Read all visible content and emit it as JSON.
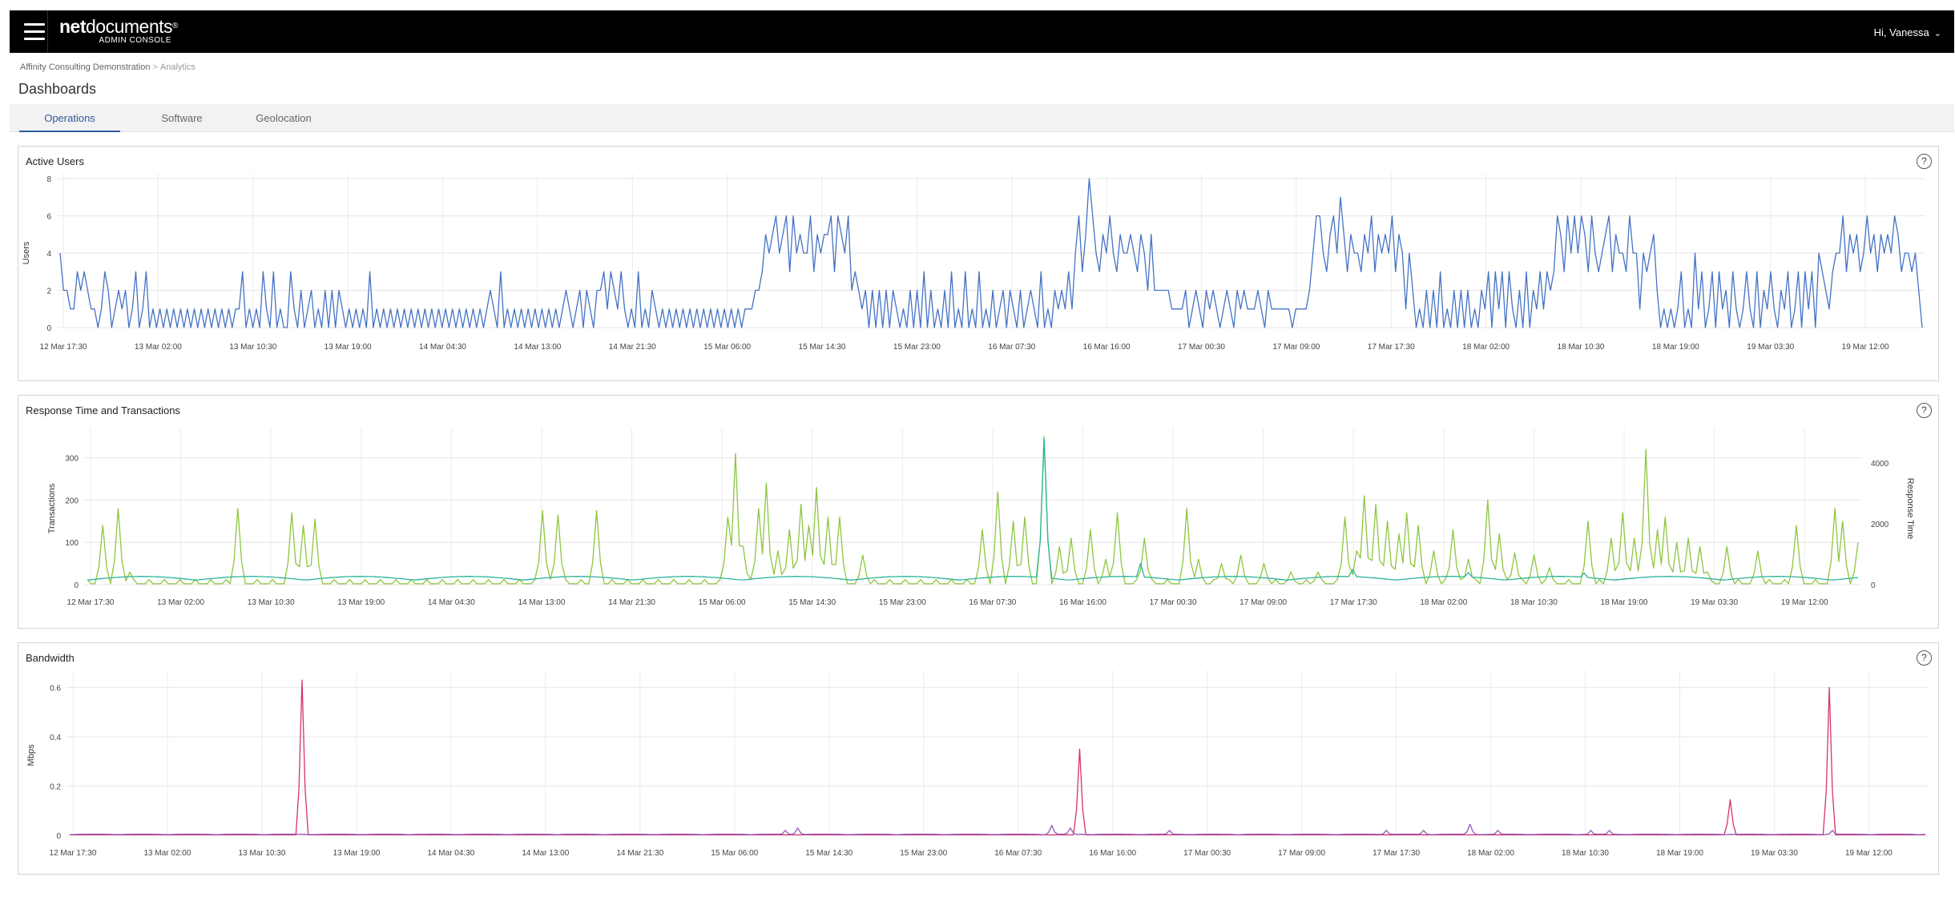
{
  "header": {
    "brand_bold": "net",
    "brand_light": "documents",
    "brand_mark": "®",
    "brand_sub": "ADMIN CONSOLE",
    "user_greeting": "Hi, Vanessa",
    "chevron_icon": "chevron-down-icon",
    "menu_icon": "hamburger-menu-icon"
  },
  "breadcrumb": {
    "items": [
      "Affinity Consulting Demonstration",
      "Analytics"
    ],
    "separator": ">"
  },
  "page": {
    "title": "Dashboards"
  },
  "tabs": [
    {
      "label": "Operations",
      "active": true
    },
    {
      "label": "Software",
      "active": false
    },
    {
      "label": "Geolocation",
      "active": false
    }
  ],
  "colors": {
    "accent": "#2e5aa0",
    "active_users": "#4472c4",
    "transactions": "#8dc63f",
    "response_time": "#2bb59b",
    "bandwidth_a": "#d6336c",
    "bandwidth_b": "#9b59b6"
  },
  "panels": {
    "active_users": {
      "title": "Active Users",
      "help": "?"
    },
    "response": {
      "title": "Response Time and Transactions",
      "help": "?"
    },
    "bandwidth": {
      "title": "Bandwidth",
      "help": "?"
    }
  },
  "chart_data": [
    {
      "id": "active_users",
      "type": "line",
      "title": "Active Users",
      "xlabel": "",
      "ylabel": "Users",
      "ylim": [
        0,
        8
      ],
      "yticks": [
        0,
        2,
        4,
        6,
        8
      ],
      "grid": true,
      "x_tick_labels": [
        "12 Mar 17:30",
        "13 Mar 02:00",
        "13 Mar 10:30",
        "13 Mar 19:00",
        "14 Mar 04:30",
        "14 Mar 13:00",
        "14 Mar 21:30",
        "15 Mar 06:00",
        "15 Mar 14:30",
        "15 Mar 23:00",
        "16 Mar 07:30",
        "16 Mar 16:00",
        "17 Mar 00:30",
        "17 Mar 09:00",
        "17 Mar 17:30",
        "18 Mar 02:00",
        "18 Mar 10:30",
        "18 Mar 19:00",
        "19 Mar 03:30",
        "19 Mar 12:00"
      ],
      "series": [
        {
          "color": "#4472c4",
          "values": [
            4,
            2,
            2,
            1,
            1,
            3,
            2,
            3,
            2,
            1,
            1,
            0,
            1,
            3,
            2,
            0,
            1,
            2,
            1,
            2,
            0,
            1,
            3,
            0,
            1,
            3,
            0,
            1,
            0,
            1,
            0,
            1,
            0,
            1,
            0,
            1,
            0,
            1,
            0,
            1,
            0,
            1,
            0,
            1,
            0,
            1,
            0,
            1,
            0,
            1,
            0,
            1,
            1,
            3,
            0,
            1,
            0,
            1,
            0,
            3,
            1,
            0,
            3,
            0,
            1,
            0,
            0,
            3,
            1,
            0,
            2,
            0,
            1,
            2,
            0,
            1,
            0,
            2,
            0,
            2,
            0,
            2,
            1,
            0,
            1,
            0,
            1,
            0,
            1,
            0,
            3,
            0,
            1,
            0,
            1,
            0,
            1,
            0,
            1,
            0,
            1,
            0,
            1,
            0,
            1,
            0,
            1,
            0,
            1,
            0,
            1,
            0,
            1,
            0,
            1,
            0,
            1,
            0,
            1,
            0,
            1,
            0,
            1,
            0,
            1,
            2,
            1,
            0,
            3,
            0,
            1,
            0,
            1,
            0,
            1,
            0,
            1,
            0,
            1,
            0,
            1,
            0,
            1,
            0,
            1,
            0,
            1,
            2,
            1,
            0,
            1,
            2,
            0,
            2,
            1,
            0,
            2,
            2,
            3,
            1,
            3,
            2,
            1,
            3,
            1,
            0,
            1,
            0,
            3,
            0,
            1,
            0,
            2,
            1,
            0,
            1,
            0,
            1,
            0,
            1,
            0,
            1,
            0,
            1,
            0,
            1,
            0,
            1,
            0,
            1,
            0,
            1,
            0,
            1,
            0,
            1,
            0,
            1,
            0,
            1,
            1,
            1,
            2,
            2,
            3,
            5,
            4,
            5,
            6,
            4,
            5,
            6,
            3,
            6,
            4,
            5,
            4,
            4,
            6,
            3,
            5,
            4,
            5,
            5,
            6,
            3,
            6,
            5,
            4,
            6,
            2,
            3,
            2,
            1,
            2,
            0,
            2,
            0,
            2,
            0,
            2,
            0,
            2,
            1,
            0,
            1,
            0,
            2,
            0,
            2,
            0,
            3,
            0,
            2,
            0,
            1,
            0,
            2,
            0,
            3,
            0,
            1,
            0,
            3,
            0,
            1,
            0,
            3,
            0,
            1,
            0,
            2,
            0,
            1,
            2,
            0,
            2,
            1,
            0,
            2,
            0,
            1,
            2,
            1,
            0,
            3,
            0,
            1,
            0,
            2,
            1,
            2,
            1,
            3,
            1,
            4,
            6,
            3,
            5,
            8,
            6,
            4,
            3,
            5,
            4,
            6,
            4,
            3,
            5,
            4,
            4,
            5,
            4,
            3,
            5,
            4,
            2,
            5,
            2,
            2,
            2,
            2,
            2,
            1,
            1,
            1,
            1,
            2,
            0,
            1,
            2,
            1,
            0,
            2,
            1,
            2,
            1,
            0,
            1,
            2,
            1,
            0,
            2,
            1,
            2,
            1,
            1,
            1,
            2,
            1,
            0,
            2,
            1,
            1,
            1,
            1,
            1,
            1,
            0,
            1,
            1,
            1,
            1,
            2,
            4,
            6,
            6,
            4,
            3,
            5,
            6,
            4,
            7,
            5,
            3,
            5,
            4,
            4,
            3,
            5,
            4,
            6,
            3,
            5,
            4,
            5,
            4,
            6,
            3,
            5,
            4,
            1,
            4,
            2,
            0,
            1,
            0,
            2,
            0,
            2,
            0,
            3,
            0,
            1,
            0,
            2,
            0,
            2,
            0,
            2,
            0,
            1,
            0,
            2,
            1,
            3,
            0,
            3,
            1,
            3,
            0,
            3,
            1,
            0,
            2,
            0,
            3,
            0,
            2,
            1,
            3,
            1,
            3,
            2,
            3,
            6,
            5,
            3,
            6,
            4,
            6,
            4,
            6,
            5,
            3,
            6,
            4,
            3,
            4,
            5,
            6,
            3,
            5,
            4,
            4,
            3,
            6,
            4,
            4,
            1,
            4,
            3,
            4,
            5,
            2,
            0,
            1,
            0,
            1,
            0,
            1,
            3,
            0,
            1,
            0,
            4,
            1,
            3,
            0,
            1,
            3,
            0,
            3,
            1,
            2,
            0,
            3,
            1,
            0,
            1,
            3,
            1,
            0,
            3,
            0,
            2,
            1,
            3,
            1,
            0,
            2,
            1,
            3,
            0,
            1,
            3,
            0,
            3,
            1,
            3,
            0,
            4,
            3,
            2,
            1,
            3,
            4,
            4,
            6,
            3,
            5,
            4,
            5,
            3,
            4,
            6,
            4,
            5,
            3,
            5,
            4,
            5,
            4,
            6,
            5,
            3,
            4,
            4,
            3,
            4,
            2,
            0
          ]
        }
      ]
    },
    {
      "id": "response",
      "type": "line",
      "title": "Response Time and Transactions",
      "xlabel": "",
      "ylabel": "Transactions",
      "ylabel_right": "Response Time",
      "ylim": [
        0,
        360
      ],
      "yticks": [
        0,
        100,
        200,
        300
      ],
      "ylim_right": [
        0,
        5000
      ],
      "yticks_right": [
        0,
        2000,
        4000
      ],
      "grid": true,
      "x_tick_labels": [
        "12 Mar 17:30",
        "13 Mar 02:00",
        "13 Mar 10:30",
        "13 Mar 19:00",
        "14 Mar 04:30",
        "14 Mar 13:00",
        "14 Mar 21:30",
        "15 Mar 06:00",
        "15 Mar 14:30",
        "15 Mar 23:00",
        "16 Mar 07:30",
        "16 Mar 16:00",
        "17 Mar 00:30",
        "17 Mar 09:00",
        "17 Mar 17:30",
        "18 Mar 02:00",
        "18 Mar 10:30",
        "18 Mar 19:00",
        "19 Mar 03:30",
        "19 Mar 12:00"
      ],
      "series": [
        {
          "color": "#8dc63f",
          "axis": "left",
          "peaks": [
            [
              0.008,
              140
            ],
            [
              0.018,
              180
            ],
            [
              0.025,
              30
            ],
            [
              0.084,
              180
            ],
            [
              0.115,
              170
            ],
            [
              0.122,
              140
            ],
            [
              0.128,
              155
            ],
            [
              0.258,
              175
            ],
            [
              0.265,
              165
            ],
            [
              0.288,
              175
            ],
            [
              0.362,
              160
            ],
            [
              0.365,
              310
            ],
            [
              0.37,
              90
            ],
            [
              0.378,
              180
            ],
            [
              0.384,
              240
            ],
            [
              0.39,
              80
            ],
            [
              0.396,
              130
            ],
            [
              0.402,
              190
            ],
            [
              0.408,
              140
            ],
            [
              0.412,
              230
            ],
            [
              0.418,
              160
            ],
            [
              0.425,
              160
            ],
            [
              0.438,
              70
            ],
            [
              0.506,
              130
            ],
            [
              0.515,
              220
            ],
            [
              0.522,
              150
            ],
            [
              0.53,
              160
            ],
            [
              0.54,
              350
            ],
            [
              0.548,
              90
            ],
            [
              0.556,
              110
            ],
            [
              0.566,
              130
            ],
            [
              0.575,
              60
            ],
            [
              0.582,
              170
            ],
            [
              0.598,
              110
            ],
            [
              0.62,
              180
            ],
            [
              0.628,
              60
            ],
            [
              0.64,
              50
            ],
            [
              0.652,
              70
            ],
            [
              0.665,
              50
            ],
            [
              0.68,
              30
            ],
            [
              0.696,
              30
            ],
            [
              0.71,
              160
            ],
            [
              0.716,
              80
            ],
            [
              0.722,
              210
            ],
            [
              0.728,
              190
            ],
            [
              0.734,
              150
            ],
            [
              0.74,
              120
            ],
            [
              0.746,
              170
            ],
            [
              0.752,
              140
            ],
            [
              0.76,
              80
            ],
            [
              0.772,
              130
            ],
            [
              0.78,
              60
            ],
            [
              0.79,
              200
            ],
            [
              0.798,
              120
            ],
            [
              0.806,
              75
            ],
            [
              0.818,
              70
            ],
            [
              0.825,
              40
            ],
            [
              0.848,
              150
            ],
            [
              0.86,
              110
            ],
            [
              0.868,
              170
            ],
            [
              0.874,
              110
            ],
            [
              0.88,
              320
            ],
            [
              0.886,
              130
            ],
            [
              0.892,
              160
            ],
            [
              0.898,
              100
            ],
            [
              0.904,
              110
            ],
            [
              0.91,
              90
            ],
            [
              0.916,
              30
            ],
            [
              0.926,
              90
            ],
            [
              0.944,
              80
            ],
            [
              0.965,
              140
            ],
            [
              0.986,
              180
            ],
            [
              0.992,
              150
            ],
            [
              1.0,
              100
            ]
          ]
        },
        {
          "color": "#2bb59b",
          "axis": "right",
          "peaks": [
            [
              0.54,
              4800
            ],
            [
              0.595,
              700
            ],
            [
              0.715,
              500
            ],
            [
              0.78,
              400
            ],
            [
              0.845,
              380
            ]
          ]
        }
      ]
    },
    {
      "id": "bandwidth",
      "type": "line",
      "title": "Bandwidth",
      "xlabel": "",
      "ylabel": "Mbps",
      "ylim": [
        0,
        0.65
      ],
      "yticks": [
        0,
        0.2,
        0.4,
        0.6
      ],
      "grid": true,
      "x_tick_labels": [
        "12 Mar 17:30",
        "13 Mar 02:00",
        "13 Mar 10:30",
        "13 Mar 19:00",
        "14 Mar 04:30",
        "14 Mar 13:00",
        "14 Mar 21:30",
        "15 Mar 06:00",
        "15 Mar 14:30",
        "15 Mar 23:00",
        "16 Mar 07:30",
        "16 Mar 16:00",
        "17 Mar 00:30",
        "17 Mar 09:00",
        "17 Mar 17:30",
        "18 Mar 02:00",
        "18 Mar 10:30",
        "18 Mar 19:00",
        "19 Mar 03:30",
        "19 Mar 12:00"
      ],
      "series": [
        {
          "color": "#d6336c",
          "peaks": [
            [
              0.125,
              0.63
            ],
            [
              0.545,
              0.35
            ],
            [
              0.895,
              0.145
            ],
            [
              0.948,
              0.6
            ]
          ]
        },
        {
          "color": "#9b59b6",
          "peaks": [
            [
              0.386,
              0.02
            ],
            [
              0.392,
              0.03
            ],
            [
              0.53,
              0.04
            ],
            [
              0.54,
              0.03
            ],
            [
              0.593,
              0.02
            ],
            [
              0.71,
              0.02
            ],
            [
              0.73,
              0.02
            ],
            [
              0.755,
              0.045
            ],
            [
              0.77,
              0.02
            ],
            [
              0.82,
              0.02
            ],
            [
              0.83,
              0.02
            ],
            [
              0.95,
              0.02
            ]
          ]
        }
      ]
    }
  ]
}
